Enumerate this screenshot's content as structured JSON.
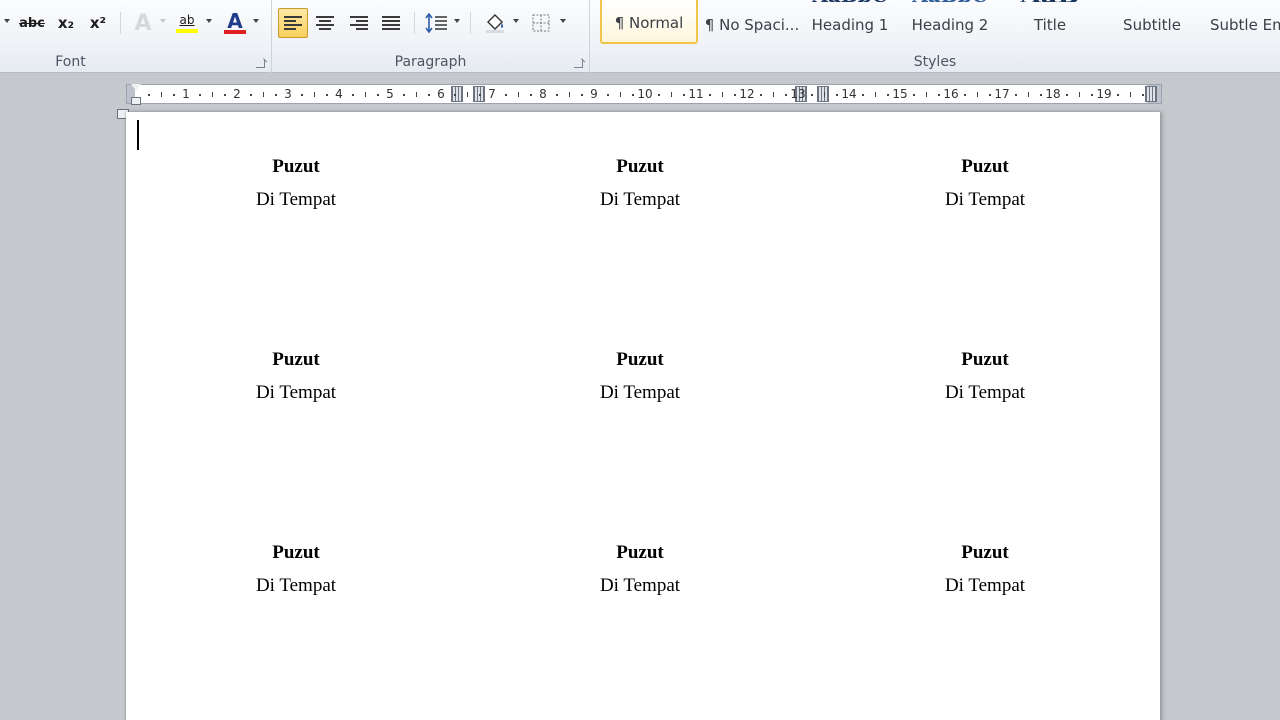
{
  "ribbon": {
    "font_group": {
      "label": "Font",
      "strike_label": "abc",
      "subscript_label": "x₂",
      "superscript_label": "x²",
      "highlight_label": "ab",
      "font_color_label": "A"
    },
    "paragraph_group": {
      "label": "Paragraph"
    },
    "styles_group": {
      "label": "Styles",
      "items": [
        {
          "label": "¶ Normal",
          "selected": true
        },
        {
          "label": "¶ No Spaci..."
        },
        {
          "label": "Heading 1"
        },
        {
          "label": "Heading 2"
        },
        {
          "label": "Title"
        },
        {
          "label": "Subtitle"
        },
        {
          "label": "Subtle Em"
        }
      ]
    }
  },
  "ruler": {
    "marks": [
      "1",
      "2",
      "3",
      "4",
      "5",
      "6",
      "7",
      "8",
      "9",
      "10",
      "11",
      "12",
      "13",
      "14",
      "15",
      "16",
      "17",
      "18",
      "19"
    ]
  },
  "document": {
    "labels": [
      {
        "name": "Puzut",
        "place": "Di Tempat"
      },
      {
        "name": "Puzut",
        "place": "Di Tempat"
      },
      {
        "name": "Puzut",
        "place": "Di Tempat"
      },
      {
        "name": "Puzut",
        "place": "Di Tempat"
      },
      {
        "name": "Puzut",
        "place": "Di Tempat"
      },
      {
        "name": "Puzut",
        "place": "Di Tempat"
      },
      {
        "name": "Puzut",
        "place": "Di Tempat"
      },
      {
        "name": "Puzut",
        "place": "Di Tempat"
      },
      {
        "name": "Puzut",
        "place": "Di Tempat"
      }
    ]
  },
  "colors": {
    "highlight": "#ffff00",
    "font_color": "#e02020",
    "selected_style_border": "#f3c44b",
    "active_button": "#f9cf5d"
  }
}
